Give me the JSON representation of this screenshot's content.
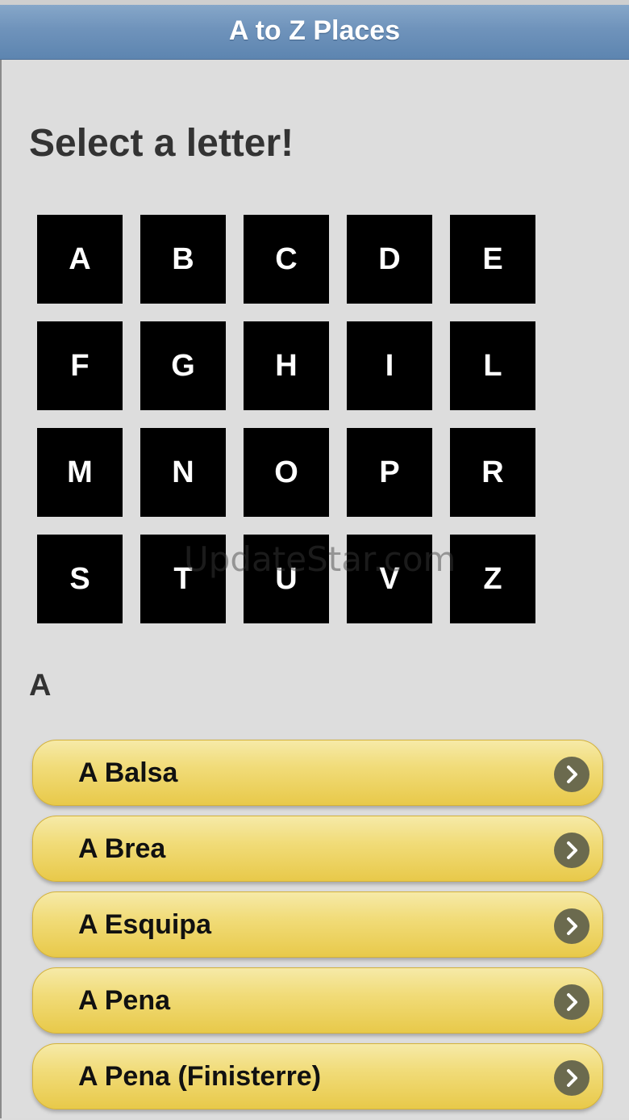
{
  "header": {
    "title": "A to Z Places"
  },
  "page_title": "Select a letter!",
  "letters": [
    "A",
    "B",
    "C",
    "D",
    "E",
    "F",
    "G",
    "H",
    "I",
    "L",
    "M",
    "N",
    "O",
    "P",
    "R",
    "S",
    "T",
    "U",
    "V",
    "Z"
  ],
  "section": {
    "letter": "A"
  },
  "places": [
    {
      "label": "A Balsa"
    },
    {
      "label": "A Brea"
    },
    {
      "label": "A Esquipa"
    },
    {
      "label": "A Pena"
    },
    {
      "label": "A Pena (Finisterre)"
    }
  ],
  "watermark": "UpdateStar.com",
  "colors": {
    "header": "#6f93bb",
    "tile": "#000000",
    "list_item": "#f1dc7a",
    "chevron": "#6b6a4e"
  },
  "icons": {
    "list_item_icon": "chevron-right-icon"
  }
}
